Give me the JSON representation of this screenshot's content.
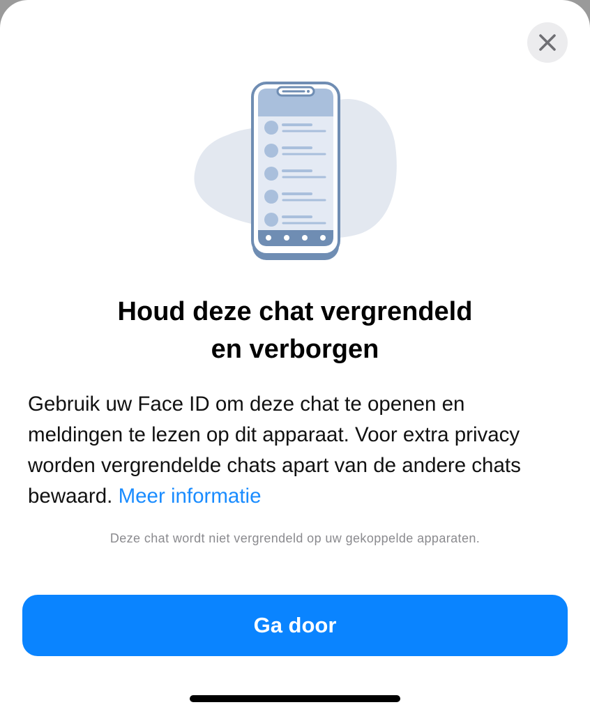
{
  "header": {
    "close_icon": "close-icon"
  },
  "illustration": {
    "icon": "locked-chats-phone-illustration",
    "colors": {
      "blob": "#e3e8f0",
      "phone_frame": "#6f8db3",
      "phone_screen": "#e4eaf4",
      "list_accent": "#a9bfdc"
    }
  },
  "content": {
    "title_line1": "Houd deze chat vergrendeld",
    "title_line2": "en verborgen",
    "body": "Gebruik uw Face ID om deze chat te openen en meldingen te lezen op dit apparaat. Voor extra privacy worden vergrendelde chats apart van de andere chats bewaard. ",
    "link_label": "Meer informatie",
    "note": "Deze chat wordt niet vergrendeld op uw gekoppelde apparaten."
  },
  "actions": {
    "continue_label": "Ga door"
  },
  "colors": {
    "accent": "#0a84ff",
    "link": "#1a8cff",
    "note_text": "#8a8a8e"
  }
}
